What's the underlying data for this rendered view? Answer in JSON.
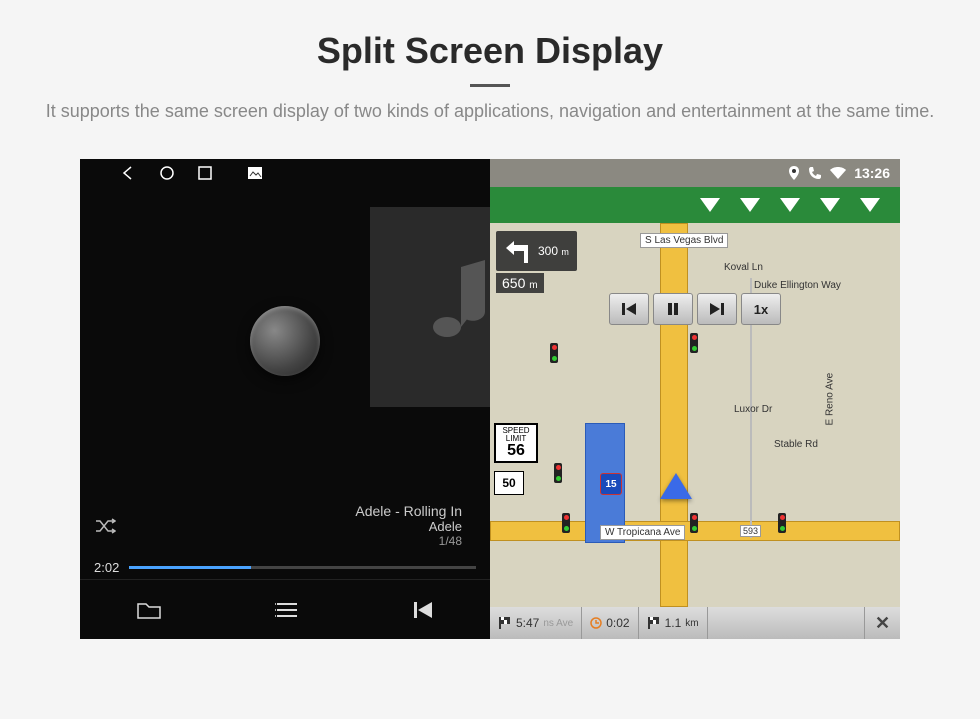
{
  "header": {
    "title": "Split Screen Display",
    "subtitle": "It supports the same screen display of two kinds of applications, navigation and entertainment at the same time."
  },
  "statusbar": {
    "time": "13:26"
  },
  "music": {
    "track": "Adele - Rolling In",
    "artist": "Adele",
    "track_count": "1/48",
    "elapsed": "2:02"
  },
  "nav": {
    "turn_dist_primary": "650",
    "turn_unit_primary": "m",
    "turn_dist_secondary": "300",
    "turn_unit_secondary": "m",
    "speed_label_top": "SPEED",
    "speed_label_bottom": "LIMIT",
    "speed_value": "56",
    "route_number": "50",
    "highway": "15",
    "playback_speed": "1x",
    "streets": {
      "s_las_vegas": "S Las Vegas Blvd",
      "koval": "Koval Ln",
      "duke": "Duke Ellington Way",
      "luxor": "Luxor Dr",
      "stable": "Stable Rd",
      "reno": "E Reno Ave",
      "tropicana": "W Tropicana Ave",
      "tropicana_num": "593",
      "bottom_street": "ns Ave"
    },
    "eta_time": "5:47",
    "eta_remaining": "0:02",
    "eta_distance": "1.1",
    "eta_distance_unit": "km"
  }
}
